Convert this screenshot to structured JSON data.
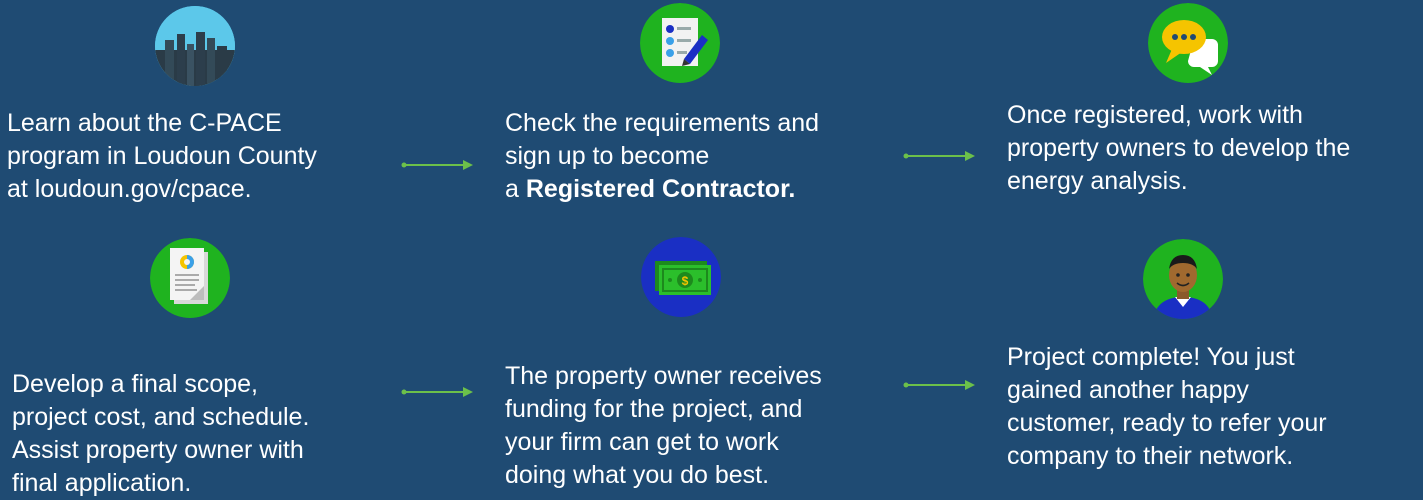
{
  "colors": {
    "background": "#1f4b73",
    "icon_green": "#1fb31f",
    "icon_blue": "#1a2fc4",
    "arrow": "#6cc04a"
  },
  "steps": [
    {
      "icon": "city-skyline-icon",
      "lines": [
        "Learn about the C-PACE",
        "program in Loudoun County",
        "at loudoun.gov/cpace."
      ]
    },
    {
      "icon": "checklist-pen-icon",
      "lines": [
        "Check the requirements and",
        "sign up to become"
      ],
      "line3_prefix": "a ",
      "line3_bold": "Registered Contractor."
    },
    {
      "icon": "chat-bubbles-icon",
      "lines": [
        "Once registered, work with",
        "property owners to develop the",
        "energy analysis."
      ]
    },
    {
      "icon": "document-chart-icon",
      "lines": [
        "Develop a final scope,",
        "project cost, and schedule.",
        "Assist property owner with",
        "final application."
      ]
    },
    {
      "icon": "money-bills-icon",
      "lines": [
        "The property owner receives",
        "funding for the project, and",
        "your firm can get to work",
        "doing what you do best."
      ]
    },
    {
      "icon": "happy-customer-icon",
      "lines": [
        "Project complete! You just",
        "gained another happy",
        "customer, ready to refer your",
        "company to their network."
      ]
    }
  ],
  "arrows": [
    "arrow-right-icon",
    "arrow-right-icon",
    "arrow-right-icon",
    "arrow-right-icon"
  ]
}
